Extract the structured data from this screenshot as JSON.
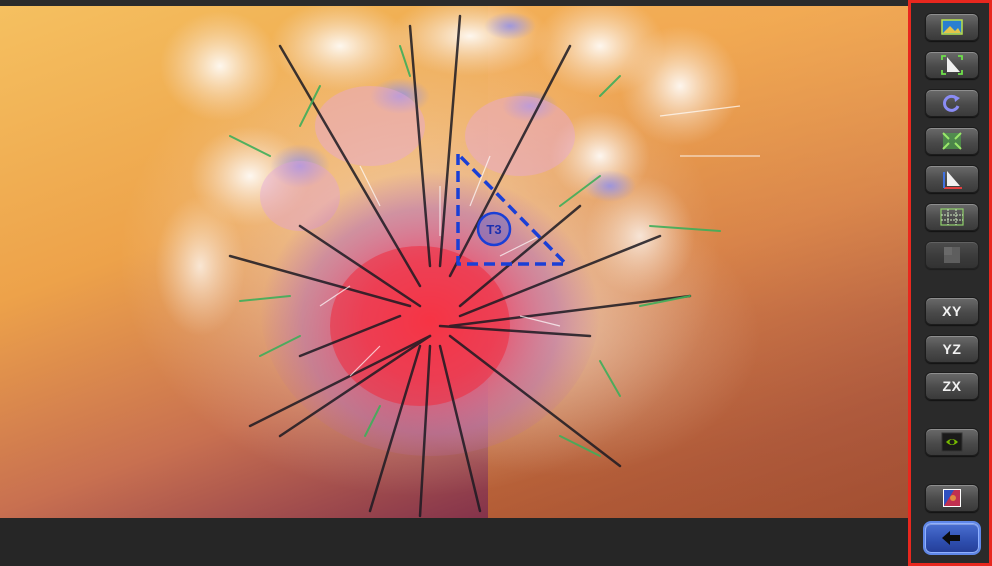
{
  "viewport": {
    "triangle_label": "T3"
  },
  "toolbar": {
    "buttons": [
      {
        "icon": "image-icon",
        "label": ""
      },
      {
        "icon": "crop-triangle-icon",
        "label": ""
      },
      {
        "icon": "rotate-icon",
        "label": ""
      },
      {
        "icon": "fit-view-icon",
        "label": ""
      },
      {
        "icon": "axis-triangle-icon",
        "label": ""
      },
      {
        "icon": "grid-icon",
        "label": ""
      },
      {
        "icon": "disabled-square-icon",
        "label": ""
      },
      {
        "icon": "",
        "label": "XY"
      },
      {
        "icon": "",
        "label": "YZ"
      },
      {
        "icon": "",
        "label": "ZX"
      },
      {
        "icon": "gpu-icon",
        "label": ""
      },
      {
        "icon": "color-map-icon",
        "label": ""
      },
      {
        "icon": "back-arrow-icon",
        "label": ""
      }
    ]
  },
  "colors": {
    "toolbar_border": "#e8271e",
    "active_button": "#3358c4",
    "triangle_stroke": "#1a3fd6"
  }
}
